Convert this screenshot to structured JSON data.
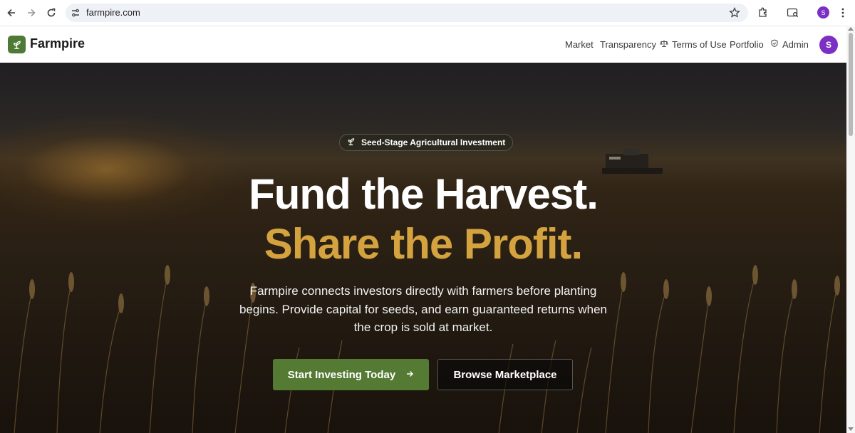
{
  "browser": {
    "url": "farmpire.com",
    "profile_initial": "S"
  },
  "header": {
    "brand": "Farmpire",
    "nav": [
      {
        "label": "Market"
      },
      {
        "label": "Transparency"
      },
      {
        "label": "Terms of Use",
        "icon": "scale-icon"
      },
      {
        "label": "Portfolio"
      },
      {
        "label": "Admin",
        "icon": "shield-icon"
      }
    ],
    "avatar_initial": "S"
  },
  "hero": {
    "badge": "Seed-Stage Agricultural Investment",
    "headline_1": "Fund the Harvest.",
    "headline_2": "Share the Profit.",
    "description": "Farmpire connects investors directly with farmers before planting begins. Provide capital for seeds, and earn guaranteed returns when the crop is sold at market.",
    "cta_primary": "Start Investing Today",
    "cta_secondary": "Browse Marketplace"
  },
  "colors": {
    "brand_green": "#557a33",
    "accent_gold": "#d4a23f",
    "avatar_purple": "#7b2fc4"
  }
}
